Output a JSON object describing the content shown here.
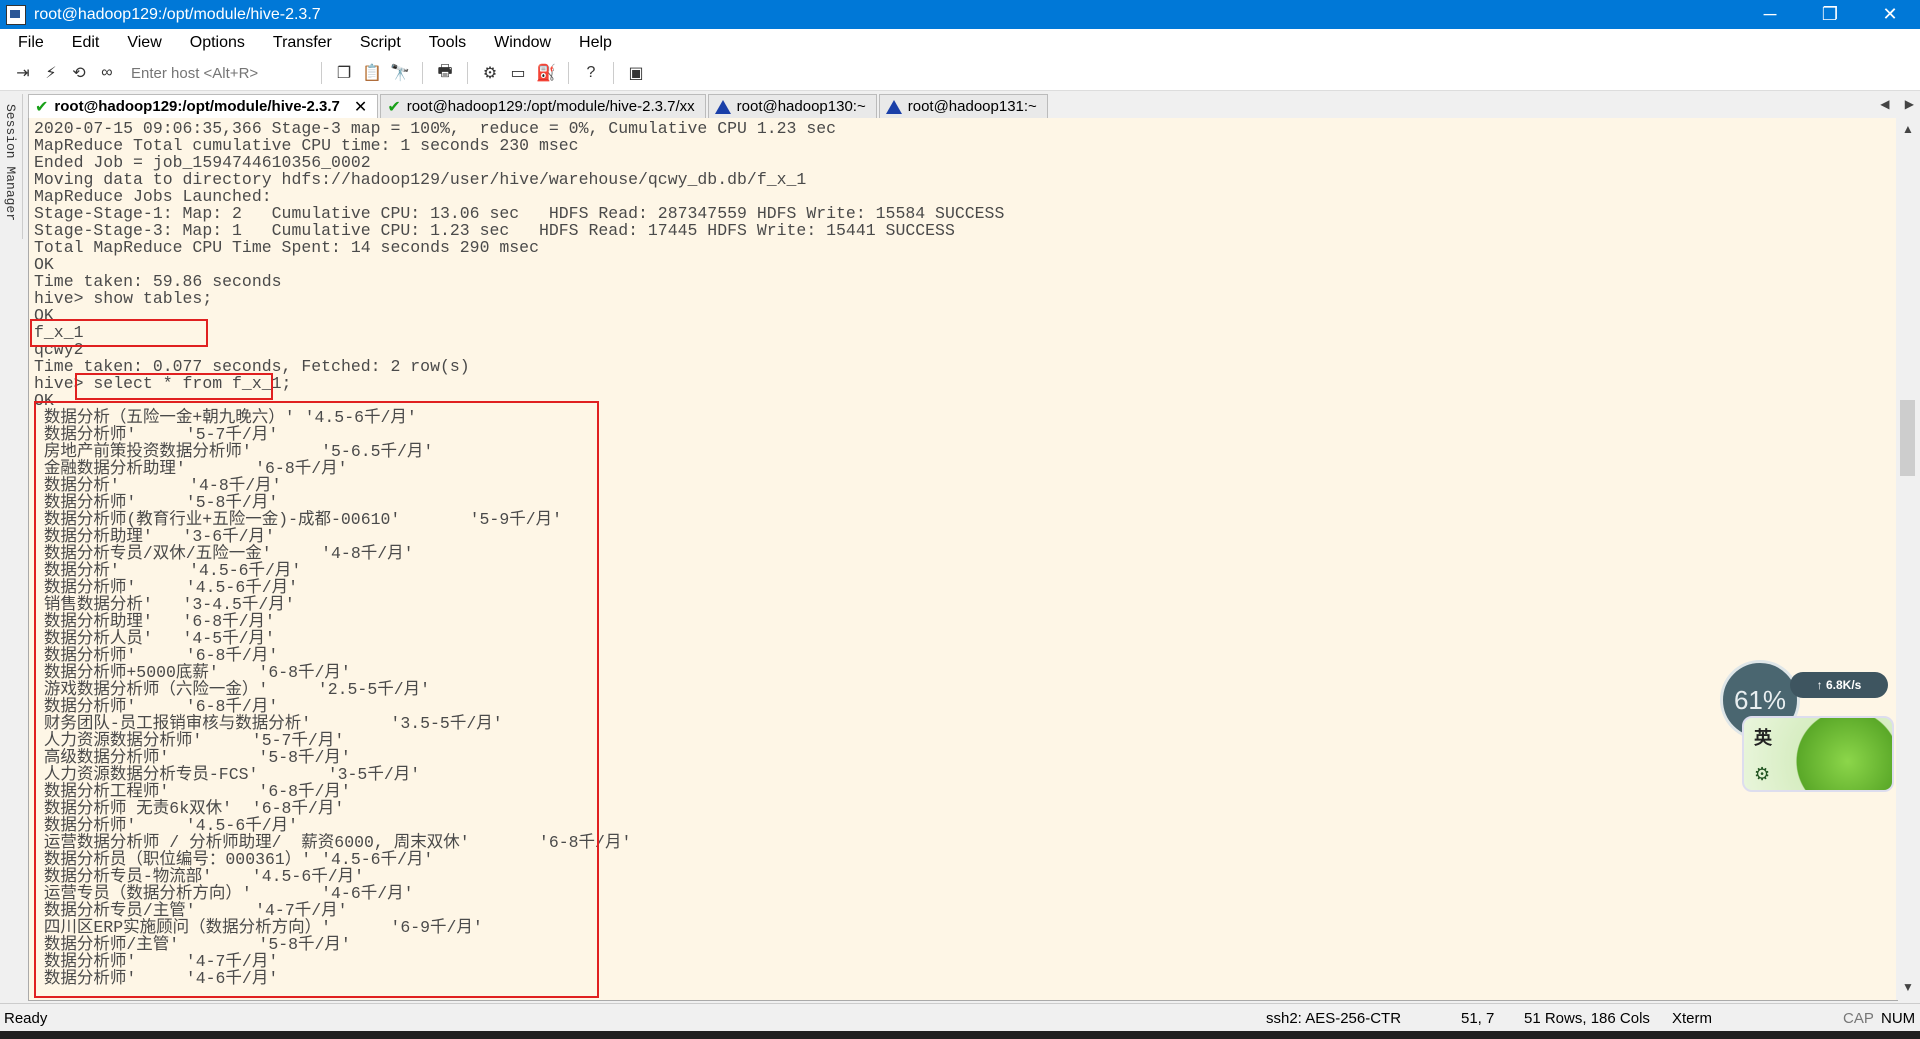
{
  "window": {
    "title": "root@hadoop129:/opt/module/hive-2.3.7",
    "controls": [
      "─",
      "❐",
      "✕"
    ]
  },
  "menu": [
    "File",
    "Edit",
    "View",
    "Options",
    "Transfer",
    "Script",
    "Tools",
    "Window",
    "Help"
  ],
  "toolbar": {
    "host_placeholder": "Enter host <Alt+R>"
  },
  "session_manager": {
    "label": "Session Manager"
  },
  "tabs": [
    {
      "label": "root@hadoop129:/opt/module/hive-2.3.7",
      "status": "connected",
      "active": true
    },
    {
      "label": "root@hadoop129:/opt/module/hive-2.3.7/xx",
      "status": "connected",
      "active": false
    },
    {
      "label": "root@hadoop130:~",
      "status": "warning",
      "active": false
    },
    {
      "label": "root@hadoop131:~",
      "status": "warning",
      "active": false
    }
  ],
  "terminal": {
    "lines": [
      "2020-07-15 09:06:35,366 Stage-3 map = 100%,  reduce = 0%, Cumulative CPU 1.23 sec",
      "MapReduce Total cumulative CPU time: 1 seconds 230 msec",
      "Ended Job = job_1594744610356_0002",
      "Moving data to directory hdfs://hadoop129/user/hive/warehouse/qcwy_db.db/f_x_1",
      "MapReduce Jobs Launched:",
      "Stage-Stage-1: Map: 2   Cumulative CPU: 13.06 sec   HDFS Read: 287347559 HDFS Write: 15584 SUCCESS",
      "Stage-Stage-3: Map: 1   Cumulative CPU: 1.23 sec   HDFS Read: 17445 HDFS Write: 15441 SUCCESS",
      "Total MapReduce CPU Time Spent: 14 seconds 290 msec",
      "OK",
      "Time taken: 59.86 seconds",
      "hive> show tables;",
      "OK",
      "f_x_1",
      "qcwy2",
      "Time taken: 0.077 seconds, Fetched: 2 row(s)",
      "hive> select * from f_x_1;",
      "OK",
      " 数据分析（五险一金+朝九晚六）' '4.5-6千/月'",
      " 数据分析师'     '5-7千/月'",
      " 房地产前策投资数据分析师'       '5-6.5千/月'",
      " 金融数据分析助理'       '6-8千/月'",
      " 数据分析'       '4-8千/月'",
      " 数据分析师'     '5-8千/月'",
      " 数据分析师(教育行业+五险一金)-成都-00610'       '5-9千/月'",
      " 数据分析助理'   '3-6千/月'",
      " 数据分析专员/双休/五险一金'     '4-8千/月'",
      " 数据分析'       '4.5-6千/月'",
      " 数据分析师'     '4.5-6千/月'",
      " 销售数据分析'   '3-4.5千/月'",
      " 数据分析助理'   '6-8千/月'",
      " 数据分析人员'   '4-5千/月'",
      " 数据分析师'     '6-8千/月'",
      " 数据分析师+5000底薪'    '6-8千/月'",
      " 游戏数据分析师（六险一金）'     '2.5-5千/月'",
      " 数据分析师'     '6-8千/月'",
      " 财务团队-员工报销审核与数据分析'        '3.5-5千/月'",
      " 人力资源数据分析师'     '5-7千/月'",
      " 高级数据分析师'         '5-8千/月'",
      " 人力资源数据分析专员-FCS'       '3-5千/月'",
      " 数据分析工程师'         '6-8千/月'",
      " 数据分析师 无责6k双休'  '6-8千/月'",
      " 数据分析师'     '4.5-6千/月'",
      " 运营数据分析师 / 分析师助理/  薪资6000, 周末双休'       '6-8千/月'",
      " 数据分析员（职位编号：000361）' '4.5-6千/月'",
      " 数据分析专员-物流部'    '4.5-6千/月'",
      " 运营专员（数据分析方向）'       '4-6千/月'",
      " 数据分析专员/主管'      '4-7千/月'",
      " 四川区ERP实施顾问（数据分析方向）'      '6-9千/月'",
      " 数据分析师/主管'        '5-8千/月'",
      " 数据分析师'     '4-7千/月'",
      " 数据分析师'     '4-6千/月'"
    ]
  },
  "status": {
    "ready": "Ready",
    "encryption": "ssh2: AES-256-CTR",
    "cursor": "51,  7",
    "size": "51 Rows, 186 Cols",
    "emulation": "Xterm",
    "caps": "CAP",
    "num": "NUM"
  },
  "widget": {
    "percent": "61%",
    "speed": "↑ 6.8K/s",
    "ime": "英"
  }
}
